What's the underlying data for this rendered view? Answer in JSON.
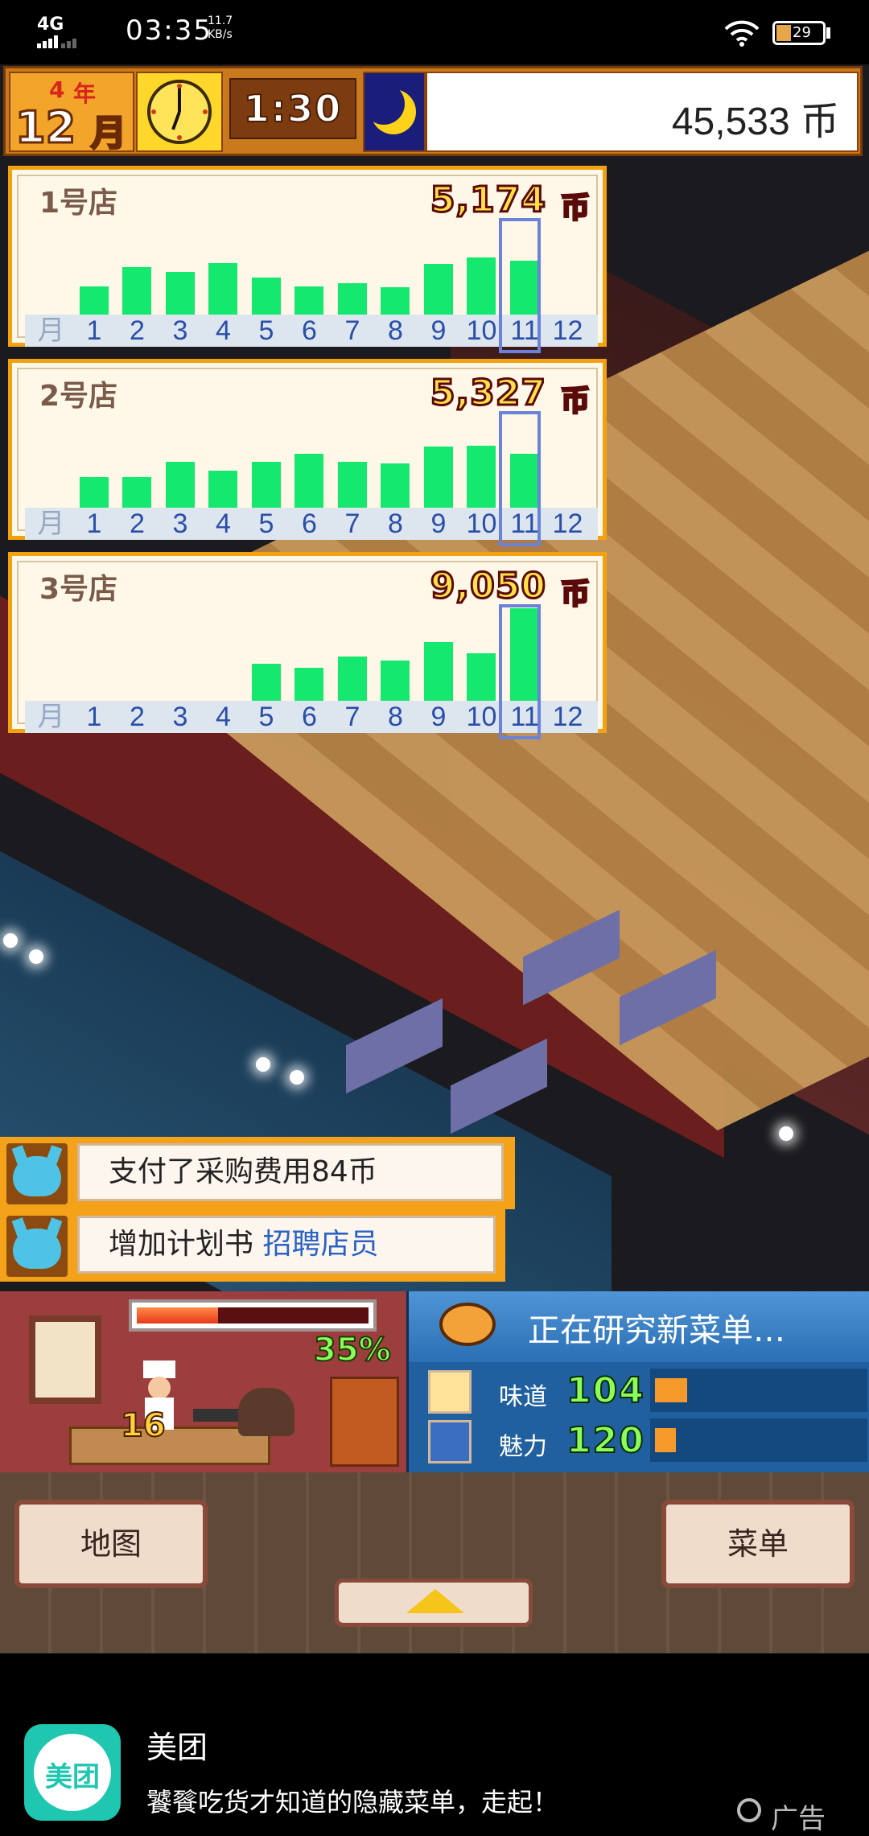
{
  "status_bar": {
    "network": "4G",
    "time": "03:35",
    "speed_value": "11.7",
    "speed_unit": "KB/s",
    "battery": "29"
  },
  "hud": {
    "year": "4",
    "year_unit": "年",
    "month": "12",
    "month_unit": "月",
    "time": "1:30",
    "money": "45,533 币"
  },
  "stores": [
    {
      "name": "1号店",
      "sales": "5,174",
      "coin": "币",
      "values": [
        0.25,
        0.42,
        0.38,
        0.46,
        0.33,
        0.25,
        0.28,
        0.24,
        0.45,
        0.51,
        0.48,
        0
      ],
      "current_month": 11
    },
    {
      "name": "2号店",
      "sales": "5,327",
      "coin": "币",
      "values": [
        0.27,
        0.27,
        0.41,
        0.33,
        0.41,
        0.48,
        0.41,
        0.39,
        0.54,
        0.55,
        0.48,
        0
      ],
      "current_month": 11
    },
    {
      "name": "3号店",
      "sales": "9,050",
      "coin": "币",
      "values": [
        0,
        0,
        0,
        0,
        0.33,
        0.29,
        0.39,
        0.36,
        0.52,
        0.42,
        0.82,
        0
      ],
      "current_month": 11
    }
  ],
  "axis": {
    "month_label": "月",
    "months": [
      "1",
      "2",
      "3",
      "4",
      "5",
      "6",
      "7",
      "8",
      "9",
      "10",
      "11",
      "12"
    ]
  },
  "notifications": [
    {
      "text": "支付了采购费用84币",
      "highlight": ""
    },
    {
      "text": "增加计划书",
      "highlight": "招聘店员"
    }
  ],
  "kitchen": {
    "progress_percent": "35%",
    "progress": 0.35,
    "cook_number": "16"
  },
  "research": {
    "title": "正在研究新菜单…",
    "taste_label": "味道",
    "taste_value": "104",
    "charm_label": "魅力",
    "charm_value": "120"
  },
  "buttons": {
    "map": "地图",
    "menu": "菜单"
  },
  "ad": {
    "logo_text": "美团",
    "brand": "美团",
    "description": "饕餮吃货才知道的隐藏菜单，走起！",
    "tag": "广告"
  },
  "colors": {
    "bar": "#14e86e",
    "panel_border": "#f2a20f",
    "research_bg": "#20609e"
  }
}
